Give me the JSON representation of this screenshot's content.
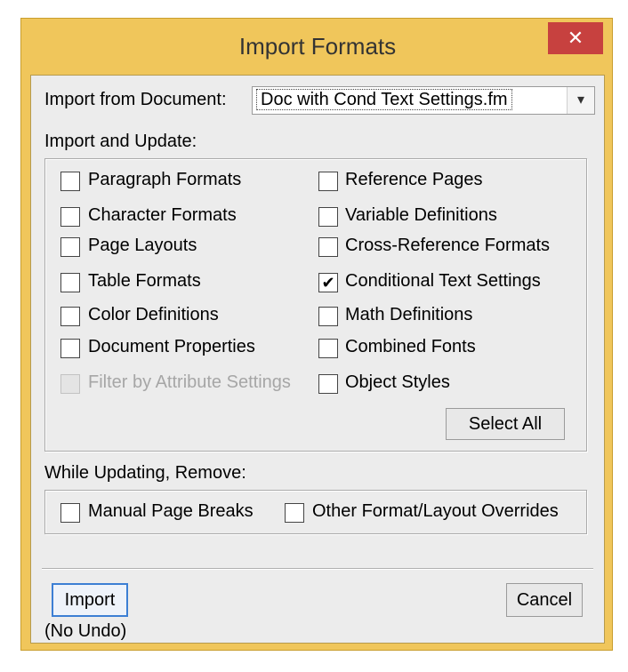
{
  "window": {
    "title": "Import Formats",
    "close_glyph": "✕"
  },
  "import_from": {
    "label": "Import from Document:",
    "value": "Doc with Cond Text Settings.fm",
    "arrow": "▾"
  },
  "import_update": {
    "label": "Import and Update:",
    "left_items": [
      {
        "label": "Paragraph Formats",
        "checked": false,
        "disabled": false
      },
      {
        "label": "Character Formats",
        "checked": false,
        "disabled": false
      },
      {
        "label": "Page Layouts",
        "checked": false,
        "disabled": false
      },
      {
        "label": "Table Formats",
        "checked": false,
        "disabled": false
      },
      {
        "label": "Color Definitions",
        "checked": false,
        "disabled": false
      },
      {
        "label": "Document Properties",
        "checked": false,
        "disabled": false
      },
      {
        "label": "Filter by Attribute Settings",
        "checked": false,
        "disabled": true
      }
    ],
    "right_items": [
      {
        "label": "Reference Pages",
        "checked": false,
        "disabled": false
      },
      {
        "label": "Variable Definitions",
        "checked": false,
        "disabled": false
      },
      {
        "label": "Cross-Reference Formats",
        "checked": false,
        "disabled": false
      },
      {
        "label": "Conditional Text Settings",
        "checked": true,
        "disabled": false
      },
      {
        "label": "Math Definitions",
        "checked": false,
        "disabled": false
      },
      {
        "label": "Combined Fonts",
        "checked": false,
        "disabled": false
      },
      {
        "label": "Object Styles",
        "checked": false,
        "disabled": false
      }
    ],
    "select_all_label": "Select All"
  },
  "remove": {
    "label": "While Updating, Remove:",
    "items": [
      {
        "label": "Manual Page Breaks",
        "checked": false
      },
      {
        "label": "Other Format/Layout Overrides",
        "checked": false
      }
    ]
  },
  "actions": {
    "import_label": "Import",
    "no_undo_label": "(No Undo)",
    "cancel_label": "Cancel"
  },
  "check_glyph": "✔"
}
